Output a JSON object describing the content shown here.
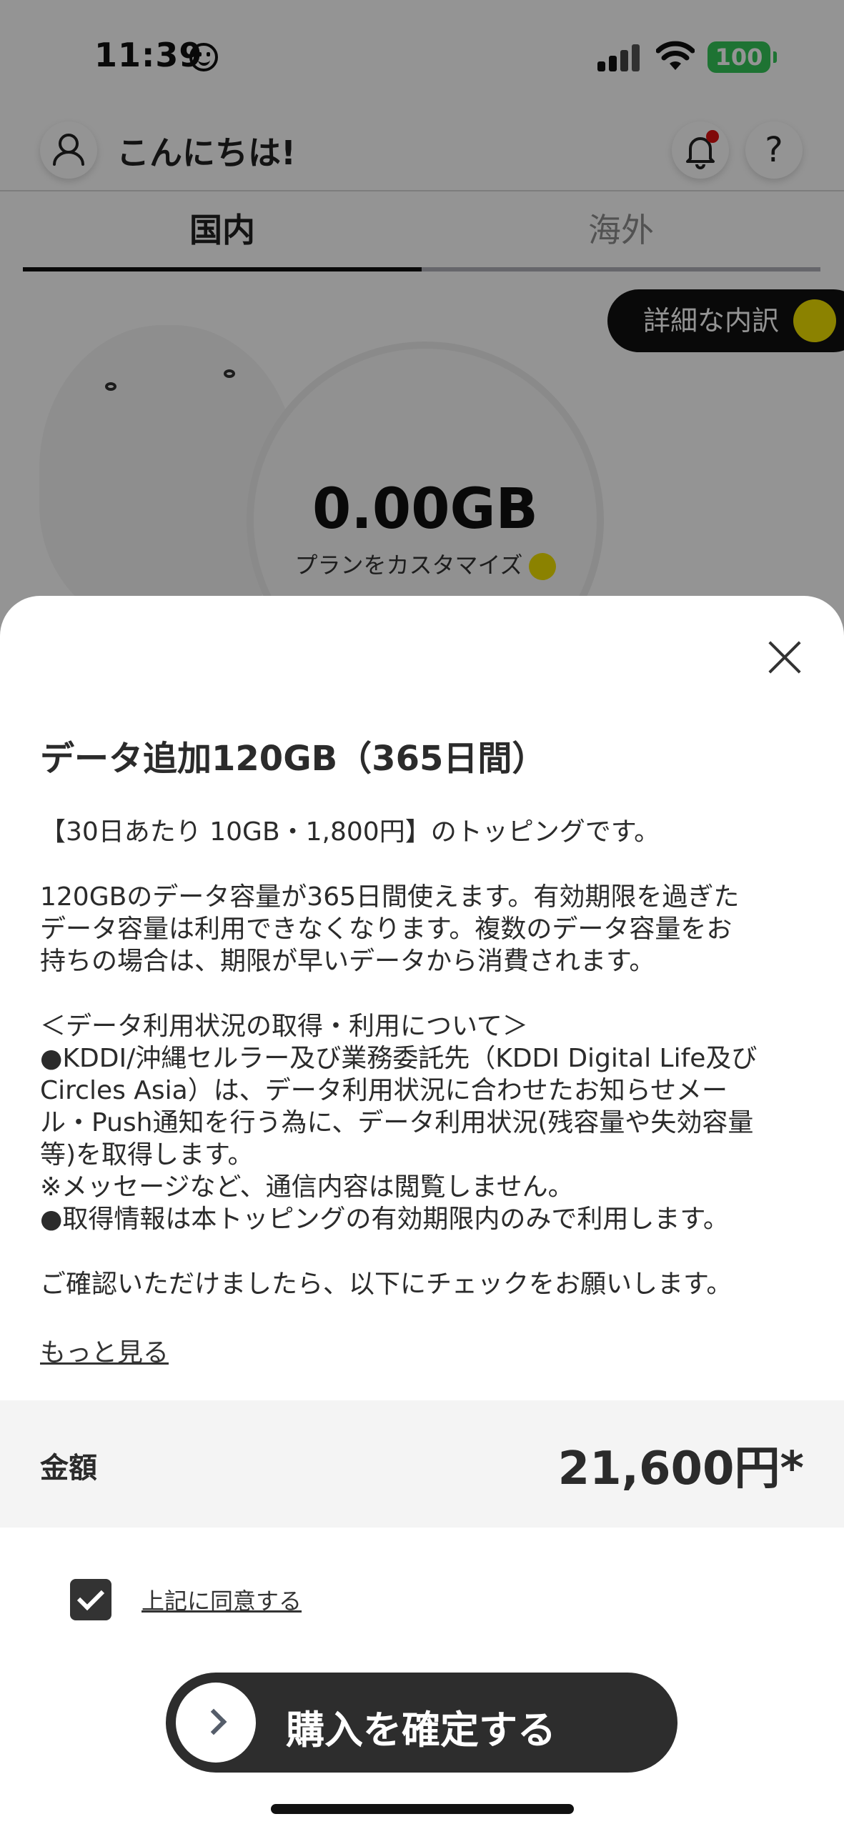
{
  "status_bar": {
    "time": "11:39",
    "battery": "100"
  },
  "header": {
    "greeting": "こんにちは!"
  },
  "tabs": [
    {
      "label": "国内"
    },
    {
      "label": "海外"
    }
  ],
  "details_button": {
    "label": "詳細な内訳"
  },
  "data_meter": {
    "amount": "0.00GB",
    "customize_label": "プランをカスタマイズ"
  },
  "sheet": {
    "title": "データ追加120GB（365日間）",
    "paragraphs": [
      "【30日あたり 10GB・1,800円】のトッピングです。",
      "120GBのデータ容量が365日間使えます。有効期限を過ぎた\nデータ容量は利用できなくなります。複数のデータ容量をお\n持ちの場合は、期限が早いデータから消費されます。",
      "＜データ利用状況の取得・利用について＞\n●KDDI/沖縄セルラー及び業務委託先（KDDI Digital Life及び\nCircles Asia）は、データ利用状況に合わせたお知らせメー\nル・Push通知を行う為に、データ利用状況(残容量や失効容量\n等)を取得します。\n※メッセージなど、通信内容は閲覧しません。\n●取得情報は本トッピングの有効期限内のみで利用します。",
      "ご確認いただけましたら、以下にチェックをお願いします。"
    ],
    "more_link": "もっと見る",
    "price_label": "金額",
    "price_value": "21,600円*",
    "agree_label": "上記に同意する",
    "agree_checked": true,
    "confirm_label": "購入を確定する"
  },
  "colors": {
    "accent_yellow": "#f0e000",
    "battery_green": "#35c759",
    "dark": "#2d2d2d"
  }
}
